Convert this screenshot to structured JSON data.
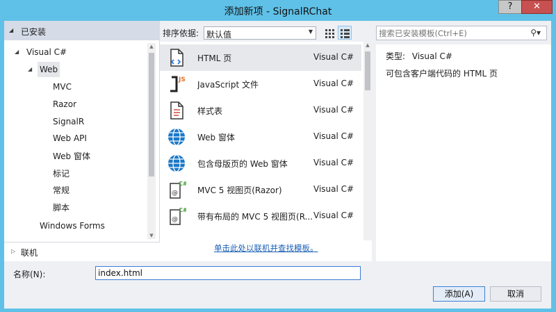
{
  "window": {
    "title": "添加新项 - SignalRChat",
    "help_label": "?",
    "close_label": "✕"
  },
  "left": {
    "installed_label": "已安装",
    "tree": [
      {
        "label": "Visual C#"
      },
      {
        "label": "Web"
      },
      {
        "label": "MVC"
      },
      {
        "label": "Razor"
      },
      {
        "label": "SignalR"
      },
      {
        "label": "Web API"
      },
      {
        "label": "Web 窗体"
      },
      {
        "label": "标记"
      },
      {
        "label": "常规"
      },
      {
        "label": "脚本"
      },
      {
        "label": "Windows Forms"
      }
    ],
    "online_label": "联机"
  },
  "sort": {
    "label": "排序依据:",
    "value": "默认值"
  },
  "templates": [
    {
      "name": "HTML 页",
      "lang": "Visual C#",
      "icon": "html-page-icon"
    },
    {
      "name": "JavaScript 文件",
      "lang": "Visual C#",
      "icon": "javascript-file-icon"
    },
    {
      "name": "样式表",
      "lang": "Visual C#",
      "icon": "stylesheet-icon"
    },
    {
      "name": "Web 窗体",
      "lang": "Visual C#",
      "icon": "globe-icon"
    },
    {
      "name": "包含母版页的 Web 窗体",
      "lang": "Visual C#",
      "icon": "globe-icon"
    },
    {
      "name": "MVC 5 视图页(Razor)",
      "lang": "Visual C#",
      "icon": "razor-view-icon"
    },
    {
      "name": "带有布局的 MVC 5 视图页(R...",
      "lang": "Visual C#",
      "icon": "razor-view-icon"
    }
  ],
  "online_link": "单击此处以联机并查找模板。",
  "search": {
    "placeholder": "搜索已安装模板(Ctrl+E)"
  },
  "details": {
    "type_label": "类型:",
    "type_value": "Visual C#",
    "description": "可包含客户端代码的 HTML 页"
  },
  "name_field": {
    "label": "名称(N):",
    "value": "index.html"
  },
  "buttons": {
    "add": "添加(A)",
    "cancel": "取消"
  },
  "colors": {
    "title_bar": "#5fc1e8",
    "close_button": "#c75050",
    "selection": "#e6e8ec"
  }
}
